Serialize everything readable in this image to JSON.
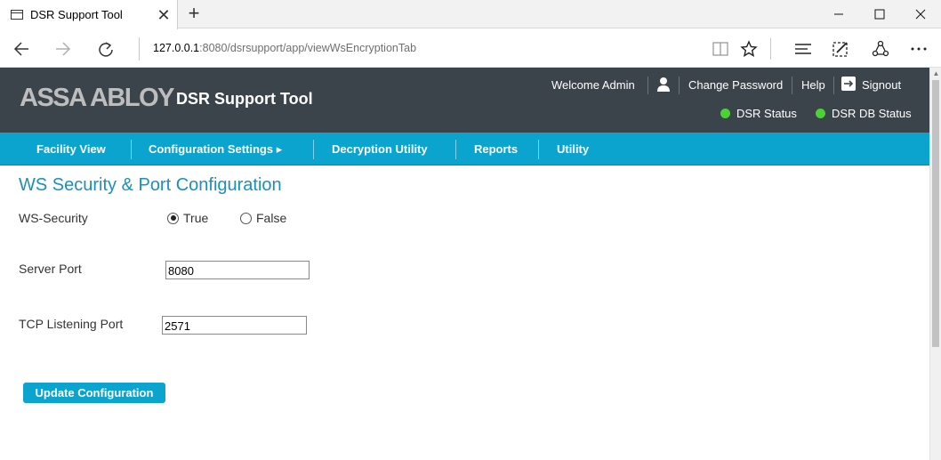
{
  "browser": {
    "tab_title": "DSR Support Tool",
    "tab_close": "✕",
    "new_tab": "+",
    "url_host": "127.0.0.1",
    "url_rest": ":8080/dsrsupport/app/viewWsEncryptionTab"
  },
  "header": {
    "logo": "ASSA ABLOY",
    "app_title": "DSR Support Tool",
    "welcome": "Welcome Admin",
    "change_password": "Change Password",
    "help": "Help",
    "signout": "Signout",
    "dsr_status": "DSR Status",
    "dsr_db_status": "DSR DB Status",
    "status_color": "#4cd137"
  },
  "nav": {
    "items": [
      {
        "label": "Facility View"
      },
      {
        "label": "Configuration Settings"
      },
      {
        "label": "Decryption Utility"
      },
      {
        "label": "Reports"
      },
      {
        "label": "Utility"
      }
    ],
    "submenu_arrow": "▸",
    "accent": "#0aa4cf"
  },
  "main": {
    "title": "WS Security & Port Configuration",
    "ws_security_label": "WS-Security",
    "radio_true": "True",
    "radio_false": "False",
    "selected": "True",
    "server_port_label": "Server Port",
    "server_port_value": "8080",
    "tcp_port_label": "TCP Listening Port",
    "tcp_port_value": "2571",
    "update_button": "Update Configuration"
  }
}
